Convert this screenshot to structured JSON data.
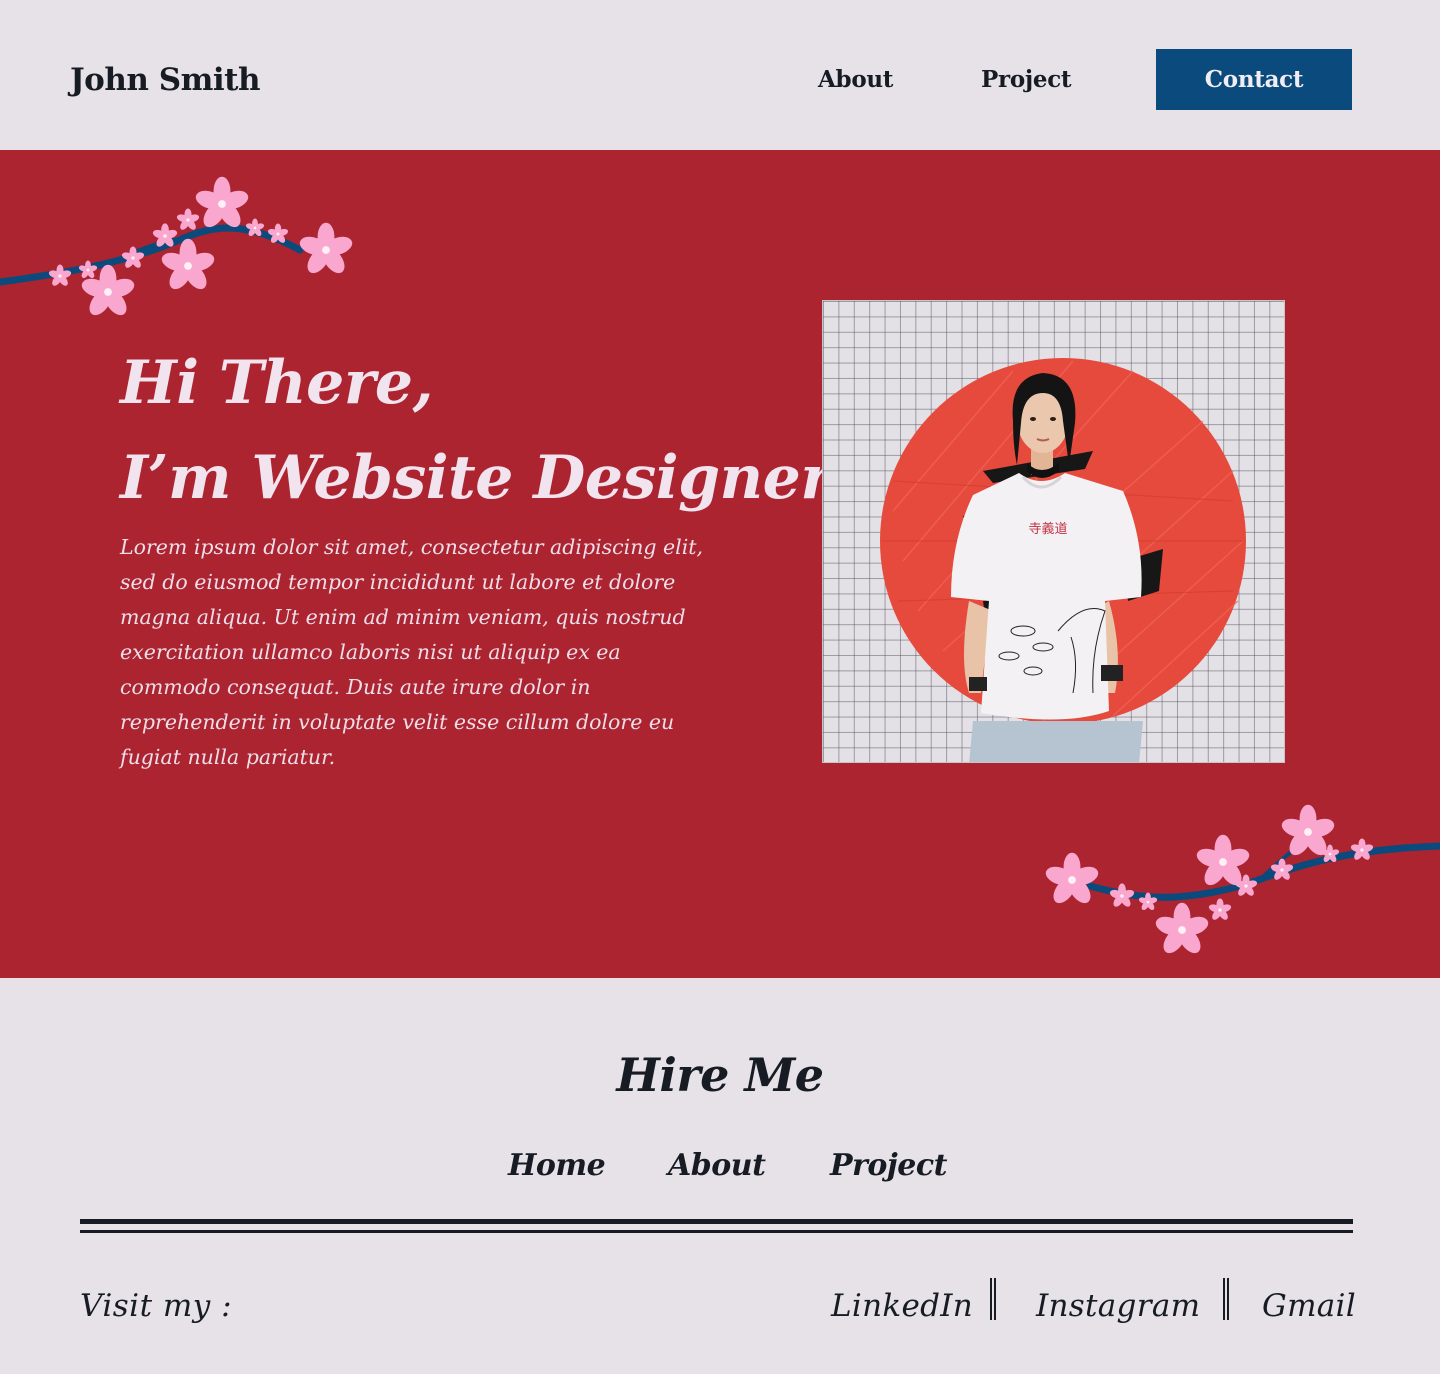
{
  "header": {
    "logo": "John Smith",
    "nav": {
      "about": "About",
      "project": "Project",
      "contact": "Contact"
    }
  },
  "hero": {
    "heading_line1": "Hi There,",
    "heading_line2": "I’m Website Designer",
    "body": "Lorem ipsum dolor sit amet, consectetur adipiscing elit, sed do eiusmod tempor incididunt ut labore et dolore magna aliqua. Ut enim ad minim veniam, quis nostrud exercitation ullamco laboris nisi ut aliquip ex ea commodo consequat. Duis aute irure dolor in reprehenderit in voluptate velit esse cillum dolore eu fugiat nulla pariatur.",
    "shirt_text": "寺義道"
  },
  "footer": {
    "title": "Hire Me",
    "nav": {
      "home": "Home",
      "about": "About",
      "project": "Project"
    },
    "visit_label": "Visit my :",
    "social": {
      "linkedin": "LinkedIn",
      "instagram": "Instagram",
      "gmail": "Gmail"
    }
  },
  "colors": {
    "background": "#e6e2e8",
    "hero": "#ab2430",
    "accent": "#0a4a7c",
    "text": "#171c24",
    "blossom": "#f9a7cf"
  },
  "icons": [
    "cherry-blossom-branch"
  ]
}
